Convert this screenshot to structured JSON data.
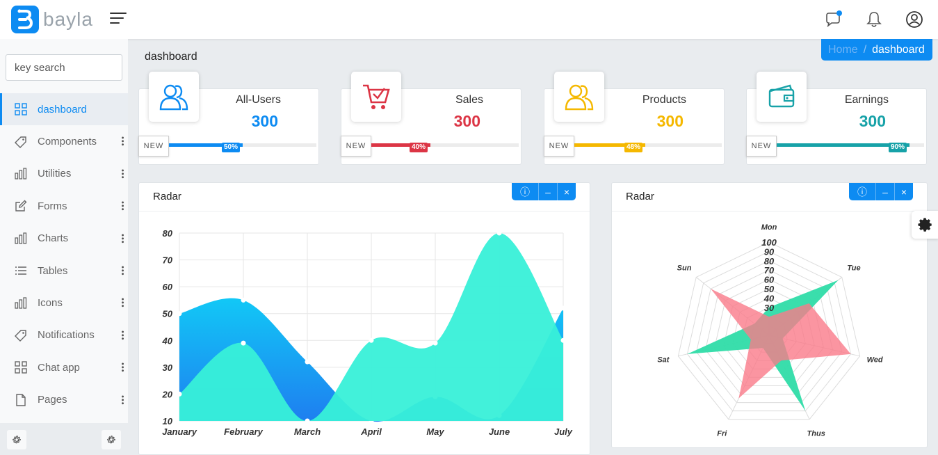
{
  "app": {
    "logo_text": "bayla"
  },
  "search": {
    "placeholder": "key search"
  },
  "page": {
    "title": "dashboard"
  },
  "breadcrumb": {
    "home": "Home",
    "separator": "/",
    "current": "dashboard"
  },
  "sidebar": {
    "items": [
      {
        "label": "dashboard",
        "icon": "grid-icon",
        "active": true
      },
      {
        "label": "Components",
        "icon": "tag-icon"
      },
      {
        "label": "Utilities",
        "icon": "bar-chart-icon"
      },
      {
        "label": "Forms",
        "icon": "edit-icon"
      },
      {
        "label": "Charts",
        "icon": "bar-chart-icon"
      },
      {
        "label": "Tables",
        "icon": "list-icon"
      },
      {
        "label": "Icons",
        "icon": "bar-chart-icon"
      },
      {
        "label": "Notifications",
        "icon": "tag-icon"
      },
      {
        "label": "Chat app",
        "icon": "grid-icon"
      },
      {
        "label": "Pages",
        "icon": "file-icon"
      }
    ]
  },
  "cards": [
    {
      "title": "All-Users",
      "value": "300",
      "tag": "NEW",
      "percent": 50,
      "percent_label": "50%",
      "color": "#0d8bf2",
      "icon": "users-icon"
    },
    {
      "title": "Sales",
      "value": "300",
      "tag": "NEW",
      "percent": 40,
      "percent_label": "40%",
      "color": "#dc3545",
      "icon": "cart-icon"
    },
    {
      "title": "Products",
      "value": "300",
      "tag": "NEW",
      "percent": 48,
      "percent_label": "48%",
      "color": "#f5b800",
      "icon": "users-icon"
    },
    {
      "title": "Earnings",
      "value": "300",
      "tag": "NEW",
      "percent": 90,
      "percent_label": "90%",
      "color": "#17a2a8",
      "icon": "wallet-icon"
    }
  ],
  "panels": {
    "left": {
      "title": "Radar"
    },
    "right": {
      "title": "Radar"
    },
    "tools": {
      "info": "ⓘ",
      "minimize": "–",
      "close": "×"
    }
  },
  "chart_data": [
    {
      "type": "area",
      "title": "",
      "categories": [
        "January",
        "February",
        "March",
        "April",
        "May",
        "June",
        "July"
      ],
      "ylim": [
        10,
        80
      ],
      "yticks": [
        10,
        20,
        30,
        40,
        50,
        60,
        70,
        80
      ],
      "grid": true,
      "series": [
        {
          "values": [
            50,
            55,
            32,
            10,
            19,
            12,
            52
          ],
          "color": "#12c3f5"
        },
        {
          "values": [
            20,
            39,
            10,
            40,
            39,
            80,
            40
          ],
          "color": "#38f0d8"
        }
      ]
    },
    {
      "type": "radar",
      "title": "",
      "categories": [
        "Mon",
        "Tue",
        "Wed",
        "Thus",
        "Fri",
        "Sat",
        "Sun"
      ],
      "rlim": [
        0,
        100
      ],
      "rticks": [
        30,
        40,
        50,
        60,
        70,
        80,
        90,
        100
      ],
      "series": [
        {
          "values": [
            30,
            95,
            15,
            90,
            15,
            90,
            20
          ],
          "color": "#2fdca8"
        },
        {
          "values": [
            20,
            55,
            90,
            30,
            75,
            20,
            80
          ],
          "color": "#fa7a8a"
        }
      ]
    }
  ]
}
